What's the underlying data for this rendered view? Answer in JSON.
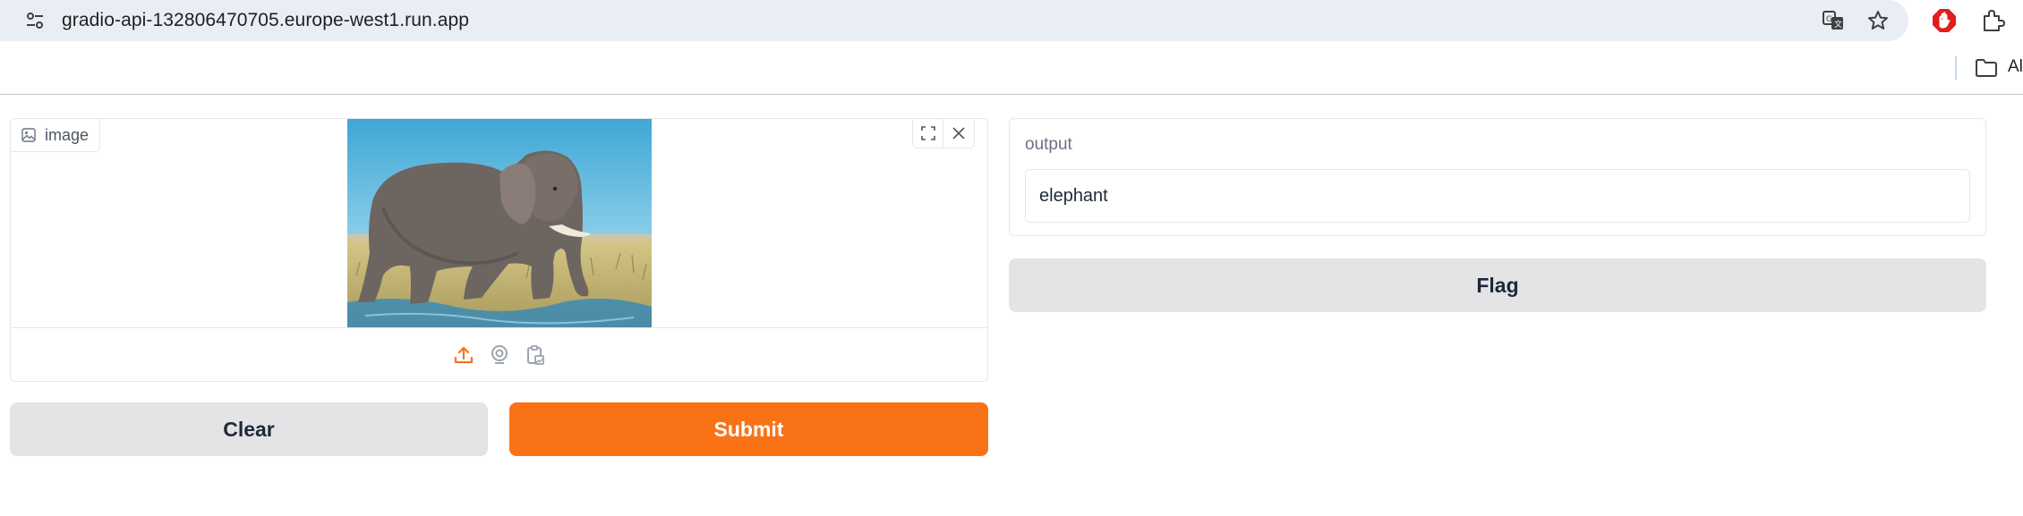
{
  "browser": {
    "url": "gradio-api-132806470705.europe-west1.run.app",
    "icons": [
      "tune-icon",
      "translate-icon",
      "star-icon",
      "extension-red-icon",
      "puzzle-extensions-icon"
    ],
    "bookmarks_label": "Al"
  },
  "input": {
    "image_label": "image",
    "image_alt": "elephant photo",
    "tools": [
      "fullscreen-icon",
      "close-icon"
    ],
    "sources": [
      "upload-icon",
      "webcam-icon",
      "clipboard-icon"
    ]
  },
  "buttons": {
    "clear": "Clear",
    "submit": "Submit",
    "flag": "Flag"
  },
  "output": {
    "label": "output",
    "value": "elephant"
  },
  "colors": {
    "accent": "#f97316",
    "secondary_button": "#e4e4e7",
    "omnibox": "#e9eef6"
  }
}
